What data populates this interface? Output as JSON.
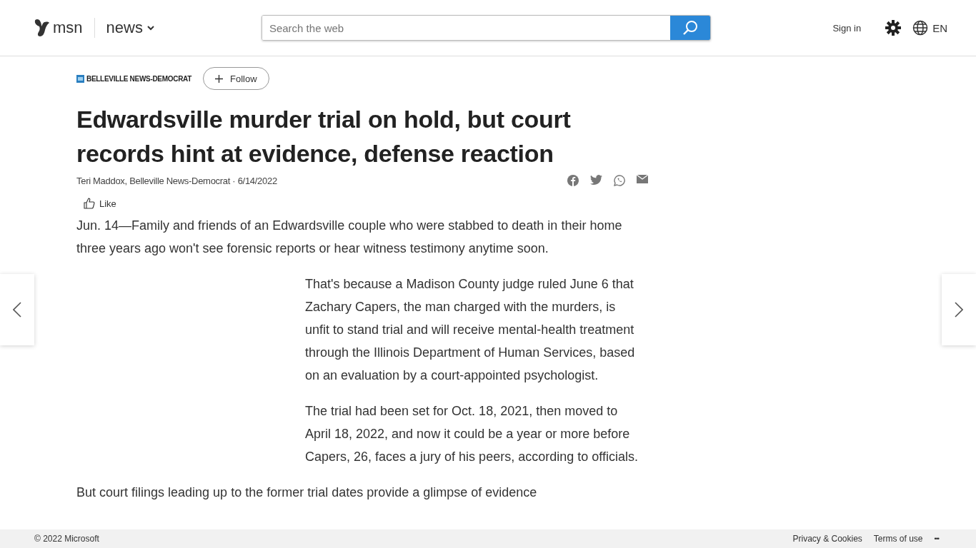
{
  "header": {
    "brand": "msn",
    "section": "news",
    "search": {
      "placeholder": "Search the web"
    },
    "sign_in": "Sign in",
    "language": "EN"
  },
  "article": {
    "source": "BELLEVILLE NEWS-DEMOCRAT",
    "follow": "Follow",
    "title": "Edwardsville murder trial on hold, but court records hint at evidence, defense reaction",
    "byline": "Teri Maddox, Belleville News-Democrat · 6/14/2022",
    "like": "Like",
    "paragraphs": [
      {
        "kind": "full",
        "text": "Jun. 14—Family and friends of an Edwardsville couple who were stabbed to death in their home three years ago won't see forensic reports or hear witness testimony anytime soon."
      },
      {
        "kind": "inset",
        "text": "That's because a Madison County judge ruled June 6 that Zachary Capers, the man charged with the murders, is unfit to stand trial and will receive mental-health treatment through the Illinois Department of Human Services, based on an evaluation by a court-appointed psychologist."
      },
      {
        "kind": "inset",
        "text": "The trial had been set for Oct. 18, 2021, then moved to April 18, 2022, and now it could be a year or more before Capers, 26, faces a jury of his peers, according to officials."
      },
      {
        "kind": "full",
        "text": "But court filings leading up to the former trial dates provide a glimpse of evidence"
      }
    ]
  },
  "footer": {
    "copyright": "© 2022 Microsoft",
    "links": [
      "Privacy & Cookies",
      "Terms of use"
    ],
    "more": "•••"
  }
}
